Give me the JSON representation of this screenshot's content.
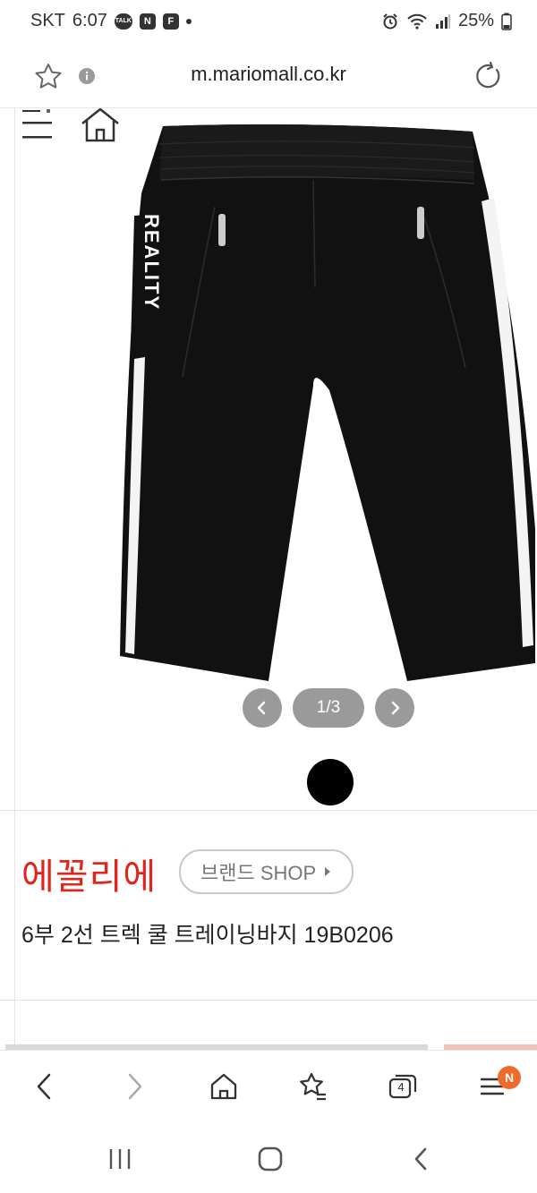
{
  "status_bar": {
    "carrier": "SKT",
    "time": "6:07",
    "badge_talk": "TALK",
    "badge_n": "N",
    "badge_f": "F",
    "battery": "25%"
  },
  "browser": {
    "url": "m.mariomall.co.kr",
    "tab_count": "4",
    "notification_badge": "N"
  },
  "product": {
    "image_print_text": "REALITY",
    "pager": "1/3",
    "brand": "에꼴리에",
    "brand_shop_label": "브랜드 SHOP",
    "name": "6부 2선 트렉 쿨 트레이닝바지 19B0206"
  },
  "colors": {
    "brand_red": "#e3241b",
    "badge_orange": "#f06a2a",
    "pager_gray": "#9a9a9a"
  },
  "icons": [
    "star-icon",
    "info-icon",
    "refresh-icon",
    "menu-icon",
    "home-icon",
    "back-icon",
    "forward-icon",
    "bookmark-star-icon",
    "tabs-icon",
    "more-menu-icon",
    "recents-icon",
    "system-home-icon",
    "system-back-icon"
  ]
}
